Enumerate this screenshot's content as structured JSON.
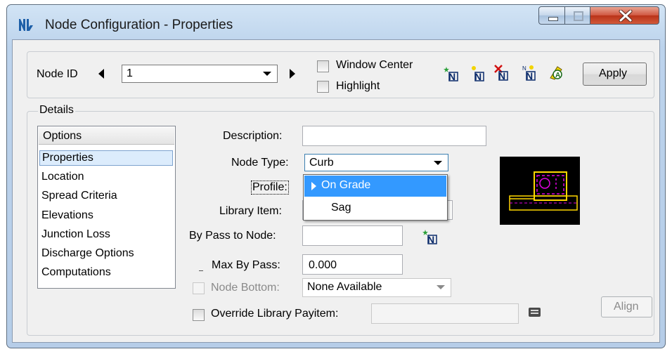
{
  "window": {
    "title": "Node Configuration - Properties",
    "controls": {
      "minimize": "minimize",
      "maximize": "maximize",
      "close": "close"
    }
  },
  "toolbar": {
    "node_id_label": "Node ID",
    "node_id_value": "1",
    "window_center_label": "Window Center",
    "highlight_label": "Highlight",
    "apply_label": "Apply",
    "icons": [
      "add-node-icon",
      "select-node-icon",
      "delete-node-icon",
      "node-number-icon",
      "library-node-icon"
    ]
  },
  "details": {
    "group_label": "Details",
    "options_header": "Options",
    "options": [
      "Properties",
      "Location",
      "Spread Criteria",
      "Elevations",
      "Junction Loss",
      "Discharge Options",
      "Computations"
    ],
    "selected_option": "Properties",
    "description_label": "Description:",
    "description_value": "",
    "node_type_label": "Node Type:",
    "node_type_value": "Curb",
    "profile_label": "Profile:",
    "profile_dropdown": [
      "On Grade",
      "Sag"
    ],
    "profile_highlighted": "On Grade",
    "library_item_label": "Library Item:",
    "bypass_label": "By Pass to Node:",
    "bypass_value": "",
    "max_bypass_label": "Max By Pass:",
    "max_bypass_value": "0.000",
    "node_bottom_label": "Node Bottom:",
    "node_bottom_value": "None Available",
    "override_label": "Override Library Payitem:",
    "override_value": "",
    "align_label": "Align"
  },
  "colors": {
    "title_bar_top": "#d2e4f5",
    "dialog_bg": "#f0f0f0",
    "selection_blue": "#3399ff",
    "list_selection": "#dcecfc",
    "preview_bg": "#000000",
    "preview_yellow": "#ffd800",
    "preview_magenta": "#e000e0"
  }
}
